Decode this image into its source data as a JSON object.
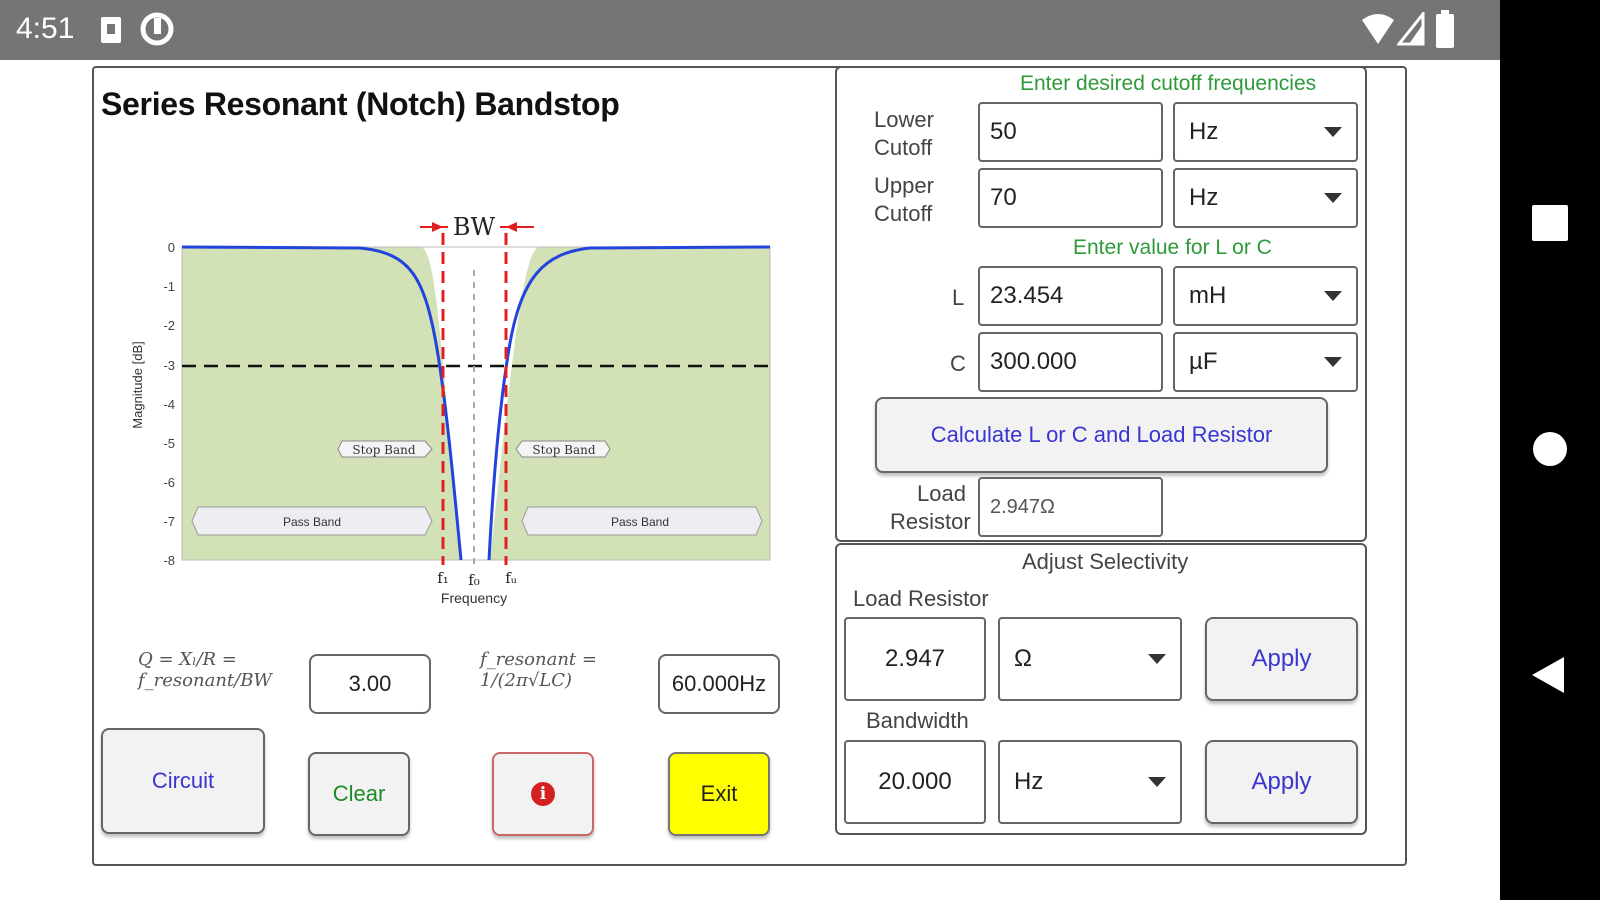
{
  "status_bar": {
    "time": "4:51"
  },
  "app": {
    "title": "Series Resonant (Notch) Bandstop"
  },
  "chart": {
    "bw_label": "BW",
    "ylabel": "Magnitude [dB]",
    "xlabel": "Frequency",
    "yticks": [
      "0",
      "-1",
      "-2",
      "-3",
      "-4",
      "-5",
      "-6",
      "-7",
      "-8"
    ],
    "f1_label": "f₁",
    "f0_label": "f₀",
    "fu_label": "fᵤ",
    "stop_band_left": "Stop Band",
    "stop_band_right": "Stop Band",
    "pass_band_left": "Pass Band",
    "pass_band_right": "Pass Band",
    "colors": {
      "fill": "#d3e1b6",
      "curve": "#2244dd",
      "cutoff": "#e02020"
    }
  },
  "formulas": {
    "q_formula": "Q = Xₗ/R = f_resonant/BW",
    "q_value": "3.00",
    "f_formula": "f_resonant = 1/(2π√LC)",
    "f_value": "60.000Hz"
  },
  "buttons": {
    "circuit": "Circuit",
    "clear": "Clear",
    "info": "i",
    "exit": "Exit"
  },
  "cutoff_panel": {
    "header": "Enter desired cutoff frequencies",
    "lower_label_1": "Lower",
    "lower_label_2": "Cutoff",
    "lower_value": "50",
    "lower_unit": "Hz",
    "upper_label_1": "Upper",
    "upper_label_2": "Cutoff",
    "upper_value": "70",
    "upper_unit": "Hz",
    "lc_header": "Enter value for L or C",
    "l_label": "L",
    "l_value": "23.454",
    "l_unit": "mH",
    "c_label": "C",
    "c_value": "300.000",
    "c_unit": "µF",
    "calculate_label": "Calculate L or C and Load Resistor",
    "load_label_1": "Load",
    "load_label_2": "Resistor",
    "load_value": "2.947Ω"
  },
  "selectivity_panel": {
    "header": "Adjust Selectivity",
    "load_label": "Load Resistor",
    "load_value": "2.947",
    "load_unit": "Ω",
    "apply_1": "Apply",
    "bandwidth_label": "Bandwidth",
    "bandwidth_value": "20.000",
    "bandwidth_unit": "Hz",
    "apply_2": "Apply"
  }
}
